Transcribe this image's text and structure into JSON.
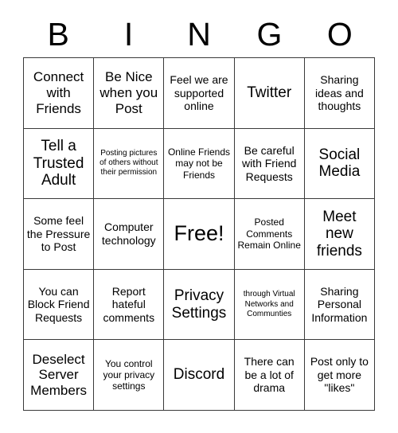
{
  "card": {
    "title": "BINGO",
    "header_letters": [
      "B",
      "I",
      "N",
      "G",
      "O"
    ],
    "columns": 5,
    "rows": 5,
    "colors": {
      "background": "#ffffff",
      "text": "#000000",
      "grid_line": "#3a3a3a"
    },
    "cells": [
      {
        "text": "Connect with Friends",
        "size": "lg",
        "free": false
      },
      {
        "text": "Be Nice when you Post",
        "size": "lg",
        "free": false
      },
      {
        "text": "Feel we are supported online",
        "size": "md",
        "free": false
      },
      {
        "text": "Twitter",
        "size": "xl",
        "free": false
      },
      {
        "text": "Sharing ideas and thoughts",
        "size": "md",
        "free": false
      },
      {
        "text": "Tell a Trusted Adult",
        "size": "xl",
        "free": false
      },
      {
        "text": "Posting pictures of others without their permission",
        "size": "xs",
        "free": false
      },
      {
        "text": "Online Friends may not be Friends",
        "size": "sm",
        "free": false
      },
      {
        "text": "Be careful with Friend Requests",
        "size": "md",
        "free": false
      },
      {
        "text": "Social Media",
        "size": "xl",
        "free": false
      },
      {
        "text": "Some feel the Pressure to Post",
        "size": "md",
        "free": false
      },
      {
        "text": "Computer technology",
        "size": "md",
        "free": false
      },
      {
        "text": "Free!",
        "size": "xxl",
        "free": true
      },
      {
        "text": "Posted Comments Remain Online",
        "size": "sm",
        "free": false
      },
      {
        "text": "Meet new friends",
        "size": "xl",
        "free": false
      },
      {
        "text": "You can Block Friend Requests",
        "size": "md",
        "free": false
      },
      {
        "text": "Report hateful comments",
        "size": "md",
        "free": false
      },
      {
        "text": "Privacy Settings",
        "size": "xl",
        "free": false
      },
      {
        "text": "through Virtual Networks and Communties",
        "size": "xs",
        "free": false
      },
      {
        "text": "Sharing Personal Information",
        "size": "md",
        "free": false
      },
      {
        "text": "Deselect Server Members",
        "size": "lg",
        "free": false
      },
      {
        "text": "You control your privacy settings",
        "size": "sm",
        "free": false
      },
      {
        "text": "Discord",
        "size": "xl",
        "free": false
      },
      {
        "text": "There can be a lot of drama",
        "size": "md",
        "free": false
      },
      {
        "text": "Post only to get more \"likes\"",
        "size": "md",
        "free": false
      }
    ]
  }
}
